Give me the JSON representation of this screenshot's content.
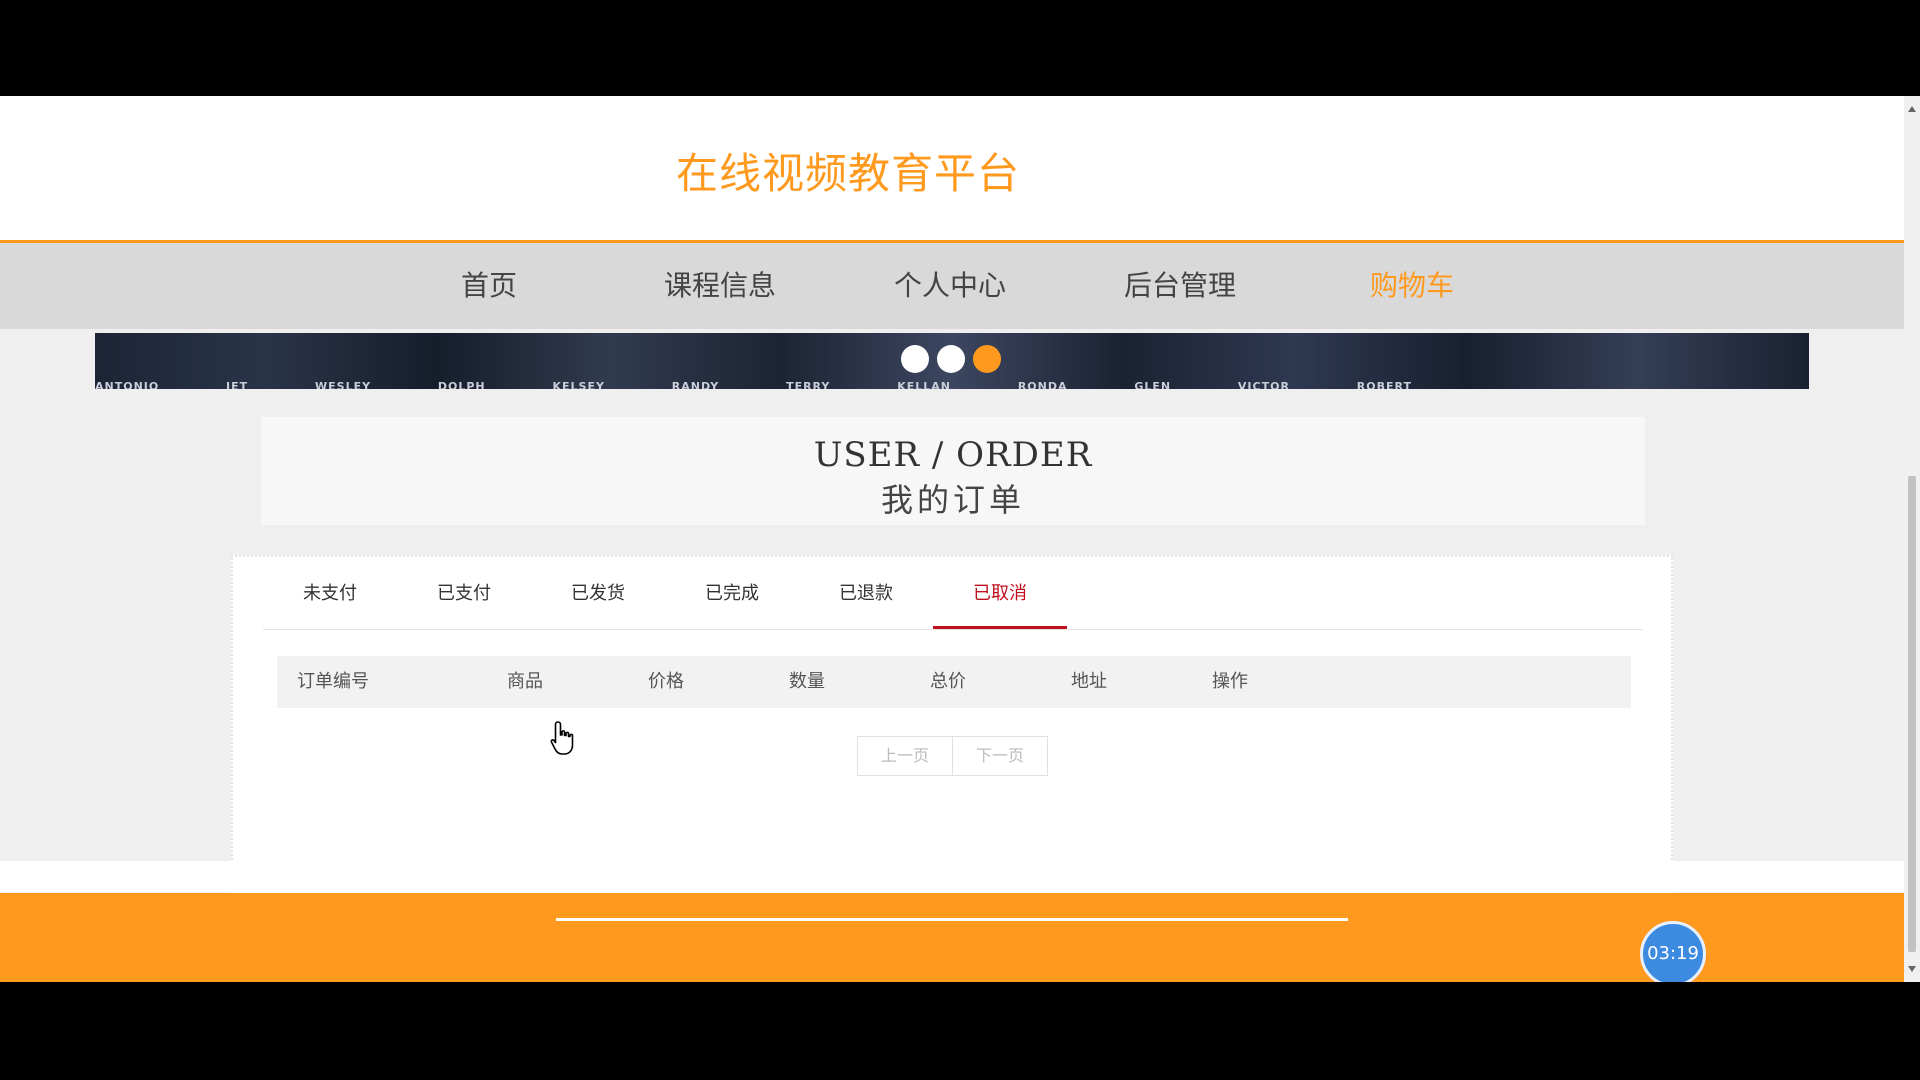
{
  "site": {
    "title": "在线视频教育平台"
  },
  "nav": {
    "items": [
      {
        "label": "首页"
      },
      {
        "label": "课程信息"
      },
      {
        "label": "个人中心"
      },
      {
        "label": "后台管理"
      },
      {
        "label": "购物车",
        "active": true
      }
    ]
  },
  "banner": {
    "names_text": "ANTONIO JET WESLEY DOLPH KELSEY RANDY TERRY KELLAN RONDA GLEN VICTOR ROBERT",
    "active_slide_index": 2,
    "slide_count": 3
  },
  "page_header": {
    "title_en": "USER / ORDER",
    "title_cn": "我的订单"
  },
  "order_tabs": [
    {
      "label": "未支付"
    },
    {
      "label": "已支付"
    },
    {
      "label": "已发货"
    },
    {
      "label": "已完成"
    },
    {
      "label": "已退款"
    },
    {
      "label": "已取消",
      "active": true
    }
  ],
  "table": {
    "columns": [
      "订单编号",
      "商品",
      "价格",
      "数量",
      "总价",
      "地址",
      "操作"
    ],
    "rows": []
  },
  "pagination": {
    "prev_label": "上一页",
    "next_label": "下一页"
  },
  "timer": {
    "label": "03:19"
  },
  "colors": {
    "brand_orange": "#ff9a1f",
    "active_tab_red": "#c0101e",
    "nav_background": "#d9d9d9",
    "timer_blue": "#3c8be0"
  },
  "icons": {
    "cursor": "hand-pointer-icon"
  }
}
